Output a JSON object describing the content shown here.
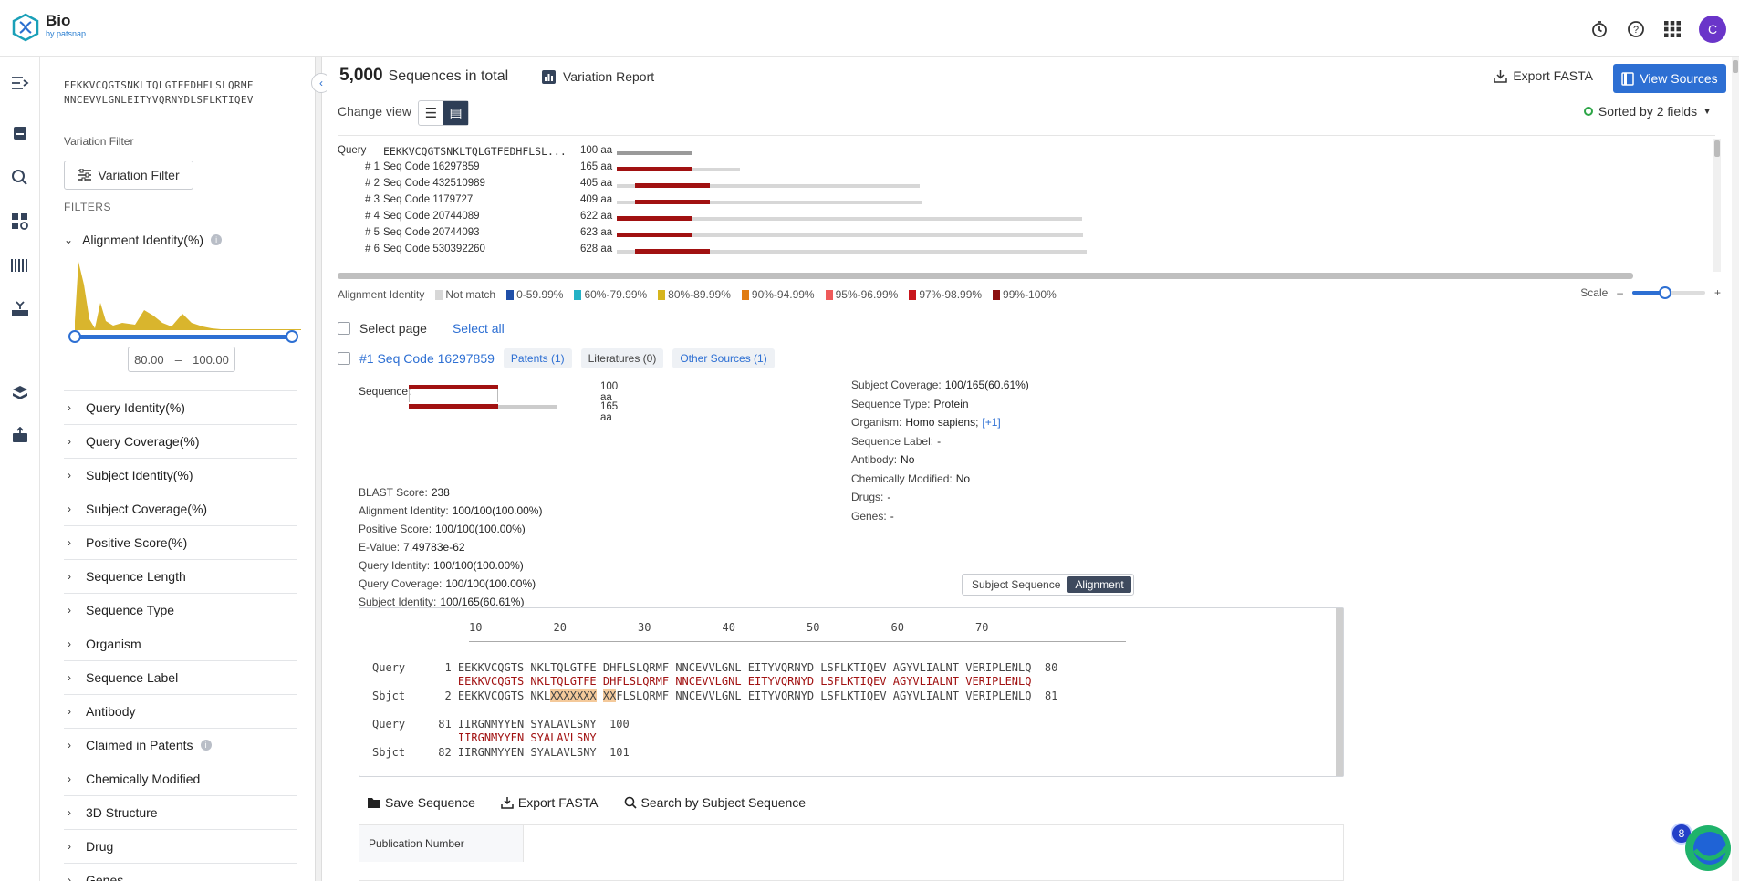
{
  "app": {
    "name": "Bio",
    "by": "by patsnap",
    "user_initial": "C"
  },
  "query_sequence": [
    "EEKKVCQGTSNKLTQLGTFEDHFLSLQRMF",
    "NNCEVVLGNLEITYVQRNYDLSFLKTIQEV"
  ],
  "variation_filter": {
    "label": "Variation Filter",
    "button": "Variation Filter"
  },
  "filters_title": "FILTERS",
  "alignment_identity": {
    "label": "Alignment Identity(%)",
    "min": "80.00",
    "sep": "–",
    "max": "100.00"
  },
  "facets": [
    "Query Identity(%)",
    "Query Coverage(%)",
    "Subject Identity(%)",
    "Subject Coverage(%)",
    "Positive Score(%)",
    "Sequence Length",
    "Sequence Type",
    "Organism",
    "Sequence Label",
    "Antibody",
    "Claimed in Patents",
    "Chemically Modified",
    "3D Structure",
    "Drug",
    "Genes"
  ],
  "summary": {
    "count": "5,000",
    "label": "Sequences in total"
  },
  "variation_report": "Variation Report",
  "export_fasta": "Export FASTA",
  "view_sources": "View Sources",
  "change_view": "Change view",
  "sorted": "Sorted by 2 fields",
  "overview": {
    "query": {
      "label": "Query",
      "seq": "EEKKVCQGTSNKLTQLGTFEDHFLSL...",
      "len": "100 aa"
    },
    "hits": [
      {
        "rank": "# 1",
        "name": "Seq Code 16297859",
        "len": "165 aa",
        "total": 165,
        "start": 0,
        "end": 100
      },
      {
        "rank": "# 2",
        "name": "Seq Code 432510989",
        "len": "405 aa",
        "total": 405,
        "start": 24,
        "end": 124
      },
      {
        "rank": "# 3",
        "name": "Seq Code 1179727",
        "len": "409 aa",
        "total": 409,
        "start": 24,
        "end": 124
      },
      {
        "rank": "# 4",
        "name": "Seq Code 20744089",
        "len": "622 aa",
        "total": 622,
        "start": 0,
        "end": 100
      },
      {
        "rank": "# 5",
        "name": "Seq Code 20744093",
        "len": "623 aa",
        "total": 623,
        "start": 0,
        "end": 100
      },
      {
        "rank": "# 6",
        "name": "Seq Code 530392260",
        "len": "628 aa",
        "total": 628,
        "start": 24,
        "end": 124
      }
    ]
  },
  "legend": {
    "title": "Alignment Identity",
    "items": [
      {
        "label": "Not match",
        "color": "#d7d7d7"
      },
      {
        "label": "0-59.99%",
        "color": "#1f4fa8"
      },
      {
        "label": "60%-79.99%",
        "color": "#23b2c6"
      },
      {
        "label": "80%-89.99%",
        "color": "#d6b51d"
      },
      {
        "label": "90%-94.99%",
        "color": "#e07c12"
      },
      {
        "label": "95%-96.99%",
        "color": "#ef5a5a"
      },
      {
        "label": "97%-98.99%",
        "color": "#c8161d"
      },
      {
        "label": "99%-100%",
        "color": "#8b0f0f"
      }
    ]
  },
  "scale": {
    "label": "Scale",
    "minus": "–",
    "plus": "+",
    "value": 0.45
  },
  "select_page": "Select page",
  "select_all": "Select all",
  "hit": {
    "rank": "#1",
    "name": "Seq Code 16297859",
    "patents": "Patents (1)",
    "literatures": "Literatures (0)",
    "other_sources": "Other Sources (1)",
    "sequence_label": "Sequence:",
    "query_len": "100 aa",
    "subject_len": "165 aa",
    "left_fields": [
      {
        "k": "BLAST Score:",
        "v": "238"
      },
      {
        "k": "Alignment Identity:",
        "v": "100/100(100.00%)"
      },
      {
        "k": "Positive Score:",
        "v": "100/100(100.00%)"
      },
      {
        "k": "E-Value:",
        "v": "7.49783e-62"
      },
      {
        "k": "Query Identity:",
        "v": "100/100(100.00%)"
      },
      {
        "k": "Query Coverage:",
        "v": "100/100(100.00%)"
      },
      {
        "k": "Subject Identity:",
        "v": "100/165(60.61%)"
      }
    ],
    "right_fields": [
      {
        "k": "Subject Coverage:",
        "v": "100/165(60.61%)"
      },
      {
        "k": "Sequence Type:",
        "v": "Protein"
      },
      {
        "k": "Organism:",
        "v": "Homo sapiens;"
      },
      {
        "k": "Sequence Label:",
        "v": "-"
      },
      {
        "k": "Antibody:",
        "v": "No"
      },
      {
        "k": "Chemically Modified:",
        "v": "No"
      },
      {
        "k": "Drugs:",
        "v": "-"
      },
      {
        "k": "Genes:",
        "v": "-"
      }
    ],
    "organism_more": "[+1]"
  },
  "align_toggle": {
    "subject": "Subject Sequence",
    "alignment": "Alignment"
  },
  "alignment": {
    "ruler": [
      "10",
      "20",
      "30",
      "40",
      "50",
      "60",
      "70"
    ],
    "lines": {
      "q1": "Query      1 EEKKVCQGTS NKLTQLGTFE DHFLSLQRMF NNCEVVLGNL EITYVQRNYD LSFLKTIQEV AGYVLIALNT VERIPLENLQ  80",
      "m1": "             EEKKVCQGTS NKLTQLGTFE DHFLSLQRMF NNCEVVLGNL EITYVQRNYD LSFLKTIQEV AGYVLIALNT VERIPLENLQ",
      "s1a": "Sbjct      2 EEKKVCQGTS NKL",
      "s1h1": "XXXXXXX",
      "s1b": " ",
      "s1h2": "XX",
      "s1c": "FLSLQRMF NNCEVVLGNL EITYVQRNYD LSFLKTIQEV AGYVLIALNT VERIPLENLQ  81",
      "q2": "Query     81 IIRGNMYYEN SYALAVLSNY  100",
      "m2": "             IIRGNMYYEN SYALAVLSNY",
      "s2": "Sbjct     82 IIRGNMYYEN SYALAVLSNY  101"
    }
  },
  "actions": {
    "save": "Save Sequence",
    "export": "Export FASTA",
    "search": "Search by Subject Sequence"
  },
  "table": {
    "col1": "Publication Number"
  },
  "chat_badge": "8"
}
